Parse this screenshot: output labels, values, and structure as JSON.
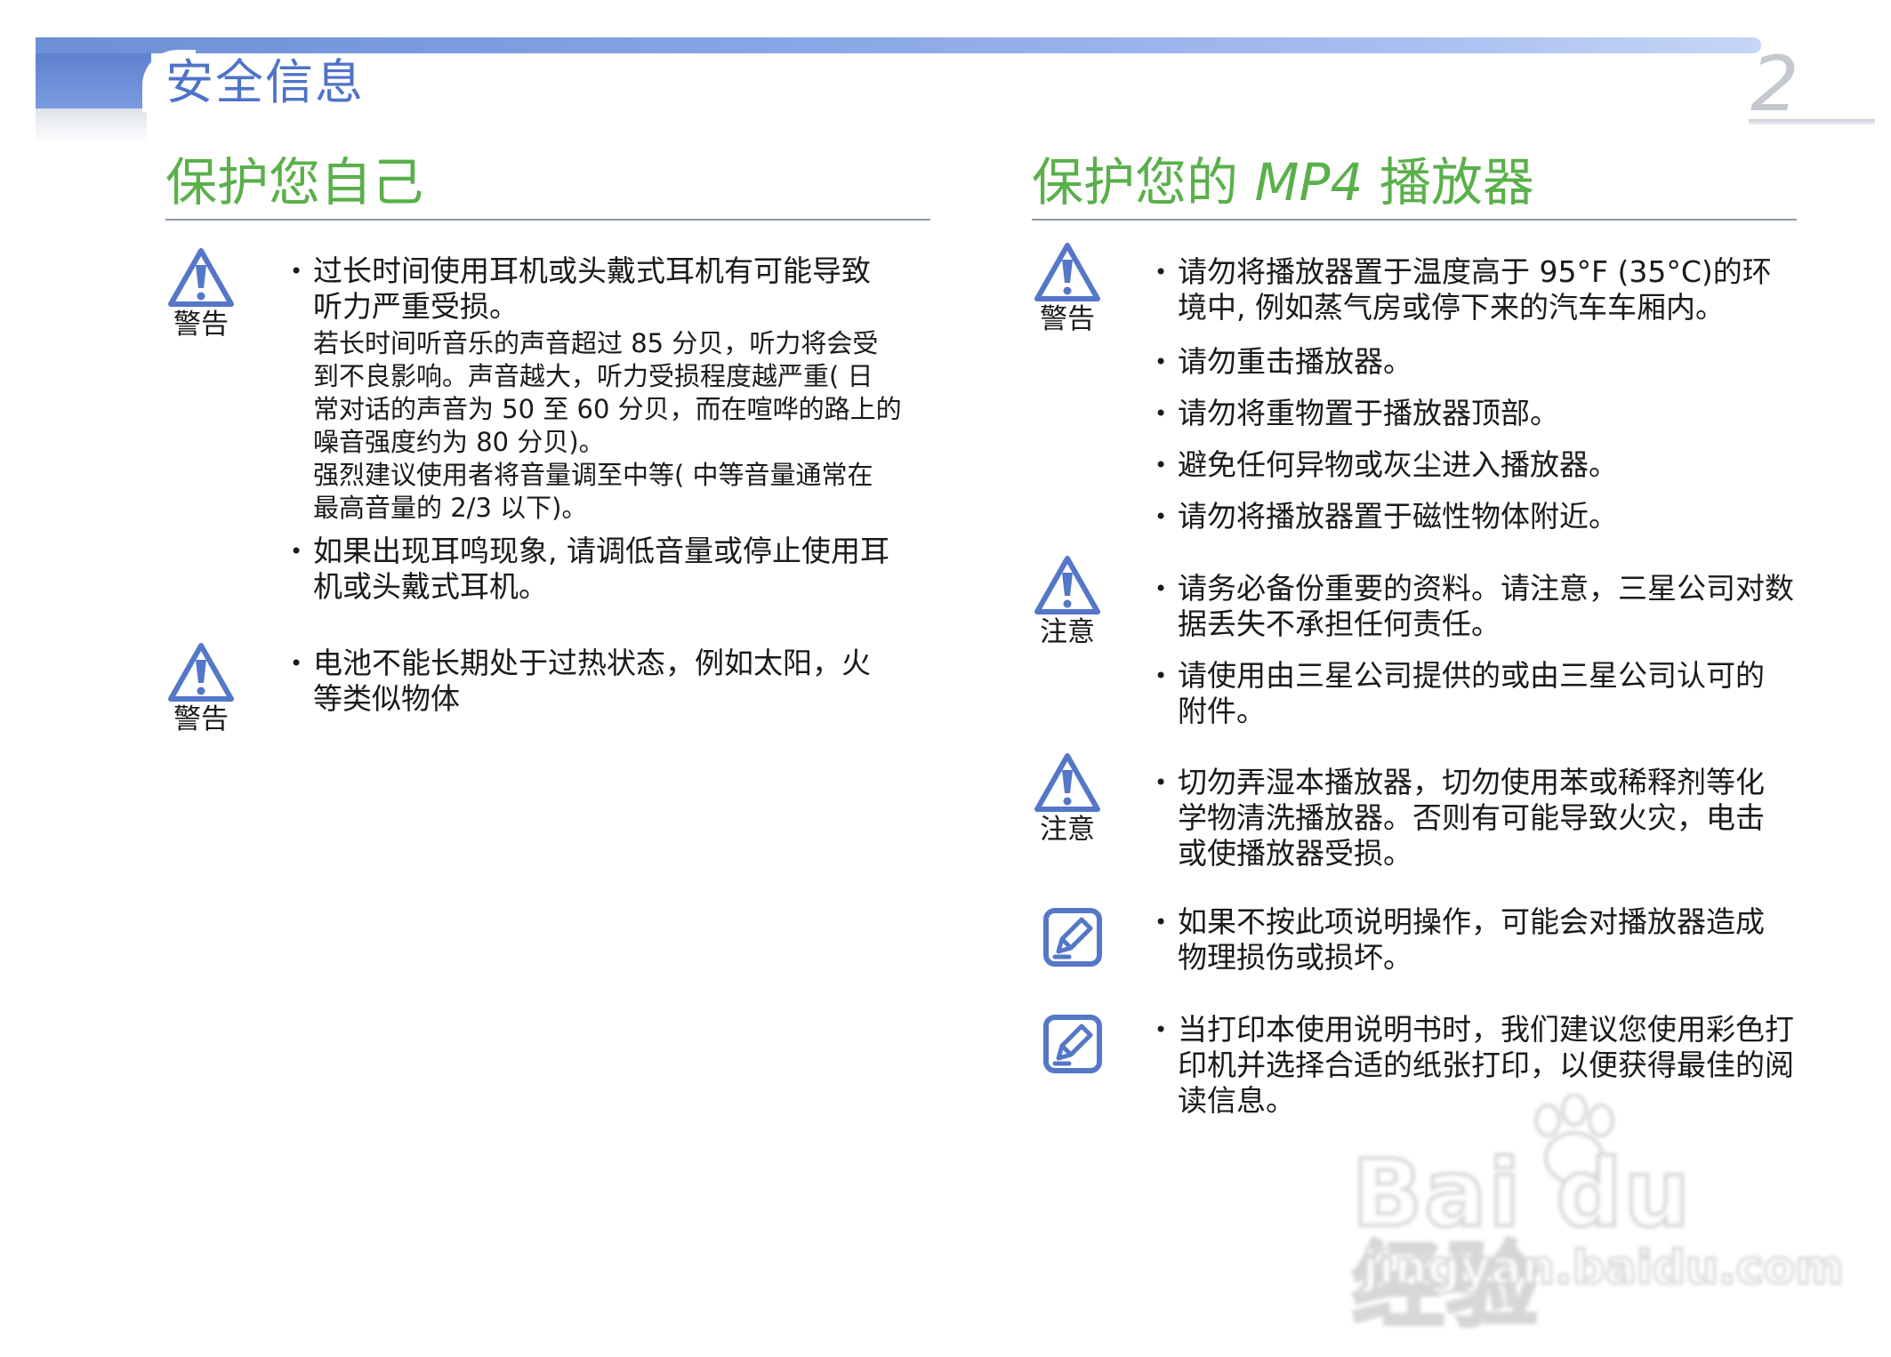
{
  "header": {
    "section_title": "安全信息",
    "page_number": "2",
    "accent_color": "#5f82cf"
  },
  "left": {
    "heading": "保护您自己",
    "blocks": [
      {
        "icon": "warning-icon",
        "label": "警告",
        "bullets": [
          {
            "lines": [
              "过长时间使用耳机或头戴式耳机有可能导致",
              "听力严重受损。"
            ],
            "sub": [
              "若长时间听音乐的声音超过  85 分贝，听力将会受",
              "到不良影响。声音越大，听力受损程度越严重(  日",
              "常对话的声音为  50 至 60 分贝，而在喧哗的路上的",
              "噪音强度约为 80 分贝)。",
              "强烈建议使用者将音量调至中等(  中等音量通常在",
              "最高音量的  2/3 以下)。"
            ]
          },
          {
            "lines": [
              "如果出现耳鸣现象, 请调低音量或停止使用耳",
              "机或头戴式耳机。"
            ]
          }
        ]
      },
      {
        "icon": "warning-icon",
        "label": "警告",
        "bullets": [
          {
            "lines": [
              "电池不能长期处于过热状态，例如太阳，火",
              "等类似物体"
            ]
          }
        ]
      }
    ]
  },
  "right": {
    "heading_cn1": "保护您的",
    "heading_latin": "MP4",
    "heading_cn2": "播放器",
    "blocks": [
      {
        "icon": "warning-icon",
        "label": "警告",
        "bullets": [
          {
            "lines": [
              "请勿将播放器置于温度高于 95°F (35°C)的环",
              "境中, 例如蒸气房或停下来的汽车车厢内。"
            ]
          },
          {
            "lines": [
              "请勿重击播放器。"
            ]
          },
          {
            "lines": [
              "请勿将重物置于播放器顶部。"
            ]
          },
          {
            "lines": [
              "避免任何异物或灰尘进入播放器。"
            ]
          },
          {
            "lines": [
              "请勿将播放器置于磁性物体附近。"
            ]
          }
        ]
      },
      {
        "icon": "caution-icon",
        "label": "注意",
        "bullets": [
          {
            "lines": [
              "请务必备份重要的资料。请注意，三星公司对数",
              "据丢失不承担任何责任。"
            ]
          },
          {
            "lines": [
              "请使用由三星公司提供的或由三星公司认可的",
              "附件。"
            ]
          }
        ]
      },
      {
        "icon": "caution-icon",
        "label": "注意",
        "bullets": [
          {
            "lines": [
              "切勿弄湿本播放器，切勿使用苯或稀释剂等化",
              "学物清洗播放器。否则有可能导致火灾，电击",
              "或使播放器受损。"
            ]
          }
        ]
      },
      {
        "icon": "note-icon",
        "bullets": [
          {
            "lines": [
              "如果不按此项说明操作，可能会对播放器造成",
              "物理损伤或损坏。"
            ]
          }
        ]
      },
      {
        "icon": "note-icon",
        "bullets": [
          {
            "lines": [
              "当打印本使用说明书时，我们建议您使用彩色打",
              "印机并选择合适的纸张打印，以便获得最佳的阅",
              "读信息。"
            ]
          }
        ]
      }
    ]
  },
  "watermark": {
    "main": "Bai du 经验",
    "sub": "jingyan.baidu.com"
  }
}
